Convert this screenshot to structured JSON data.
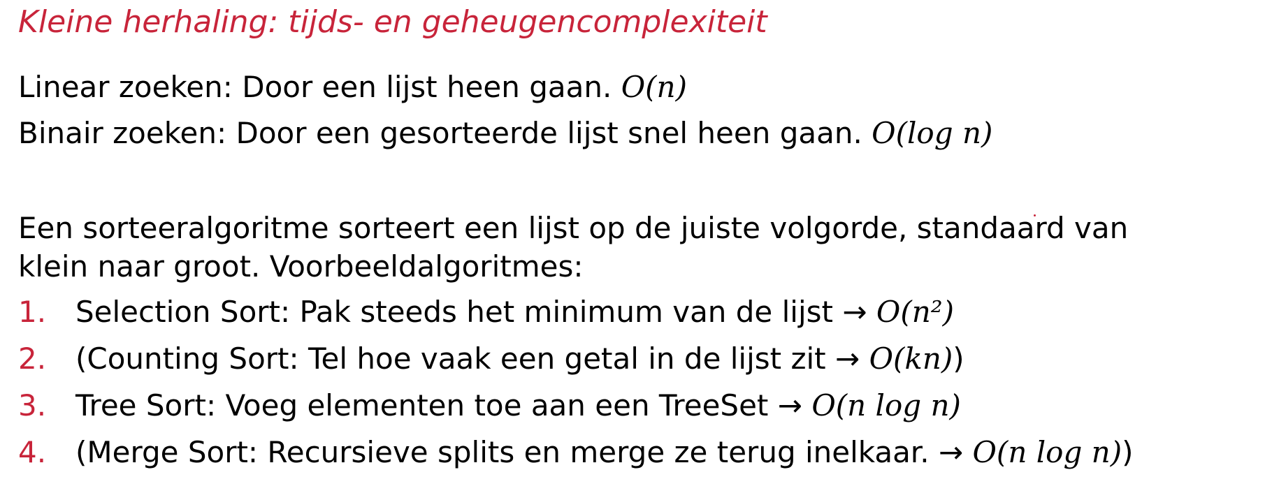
{
  "title": "Kleine herhaling: tijds- en geheugencomplexiteit",
  "colors": {
    "accent": "#c8243a",
    "text": "#000000",
    "background": "#ffffff"
  },
  "search": {
    "linear_text": "Linear zoeken: Door een lijst heen gaan.",
    "linear_math": "O(n)",
    "binary_text": "Binair zoeken: Door een gesorteerde lijst snel heen gaan.",
    "binary_math": "O(log n)"
  },
  "intro": {
    "line1": "Een sorteeralgoritme sorteert een lijst op de juiste volgorde, standaard van",
    "line2": "klein naar groot. Voorbeeldalgoritmes:"
  },
  "algorithms": [
    {
      "number": "1.",
      "text": "Selection Sort: Pak steeds het minimum van de lijst",
      "arrow": "→",
      "math": "O(n²)",
      "suffix": ""
    },
    {
      "number": "2.",
      "text": "(Counting Sort: Tel hoe vaak een getal in de lijst zit",
      "arrow": "→",
      "math": "O(kn)",
      "suffix": ")"
    },
    {
      "number": "3.",
      "text": "Tree Sort: Voeg elementen toe aan een TreeSet",
      "arrow": "→",
      "math": "O(n log n)",
      "suffix": ""
    },
    {
      "number": "4.",
      "text": "(Merge Sort: Recursieve splits en merge ze terug inelkaar.",
      "arrow": "→",
      "math": "O(n log n)",
      "suffix": ")"
    }
  ]
}
